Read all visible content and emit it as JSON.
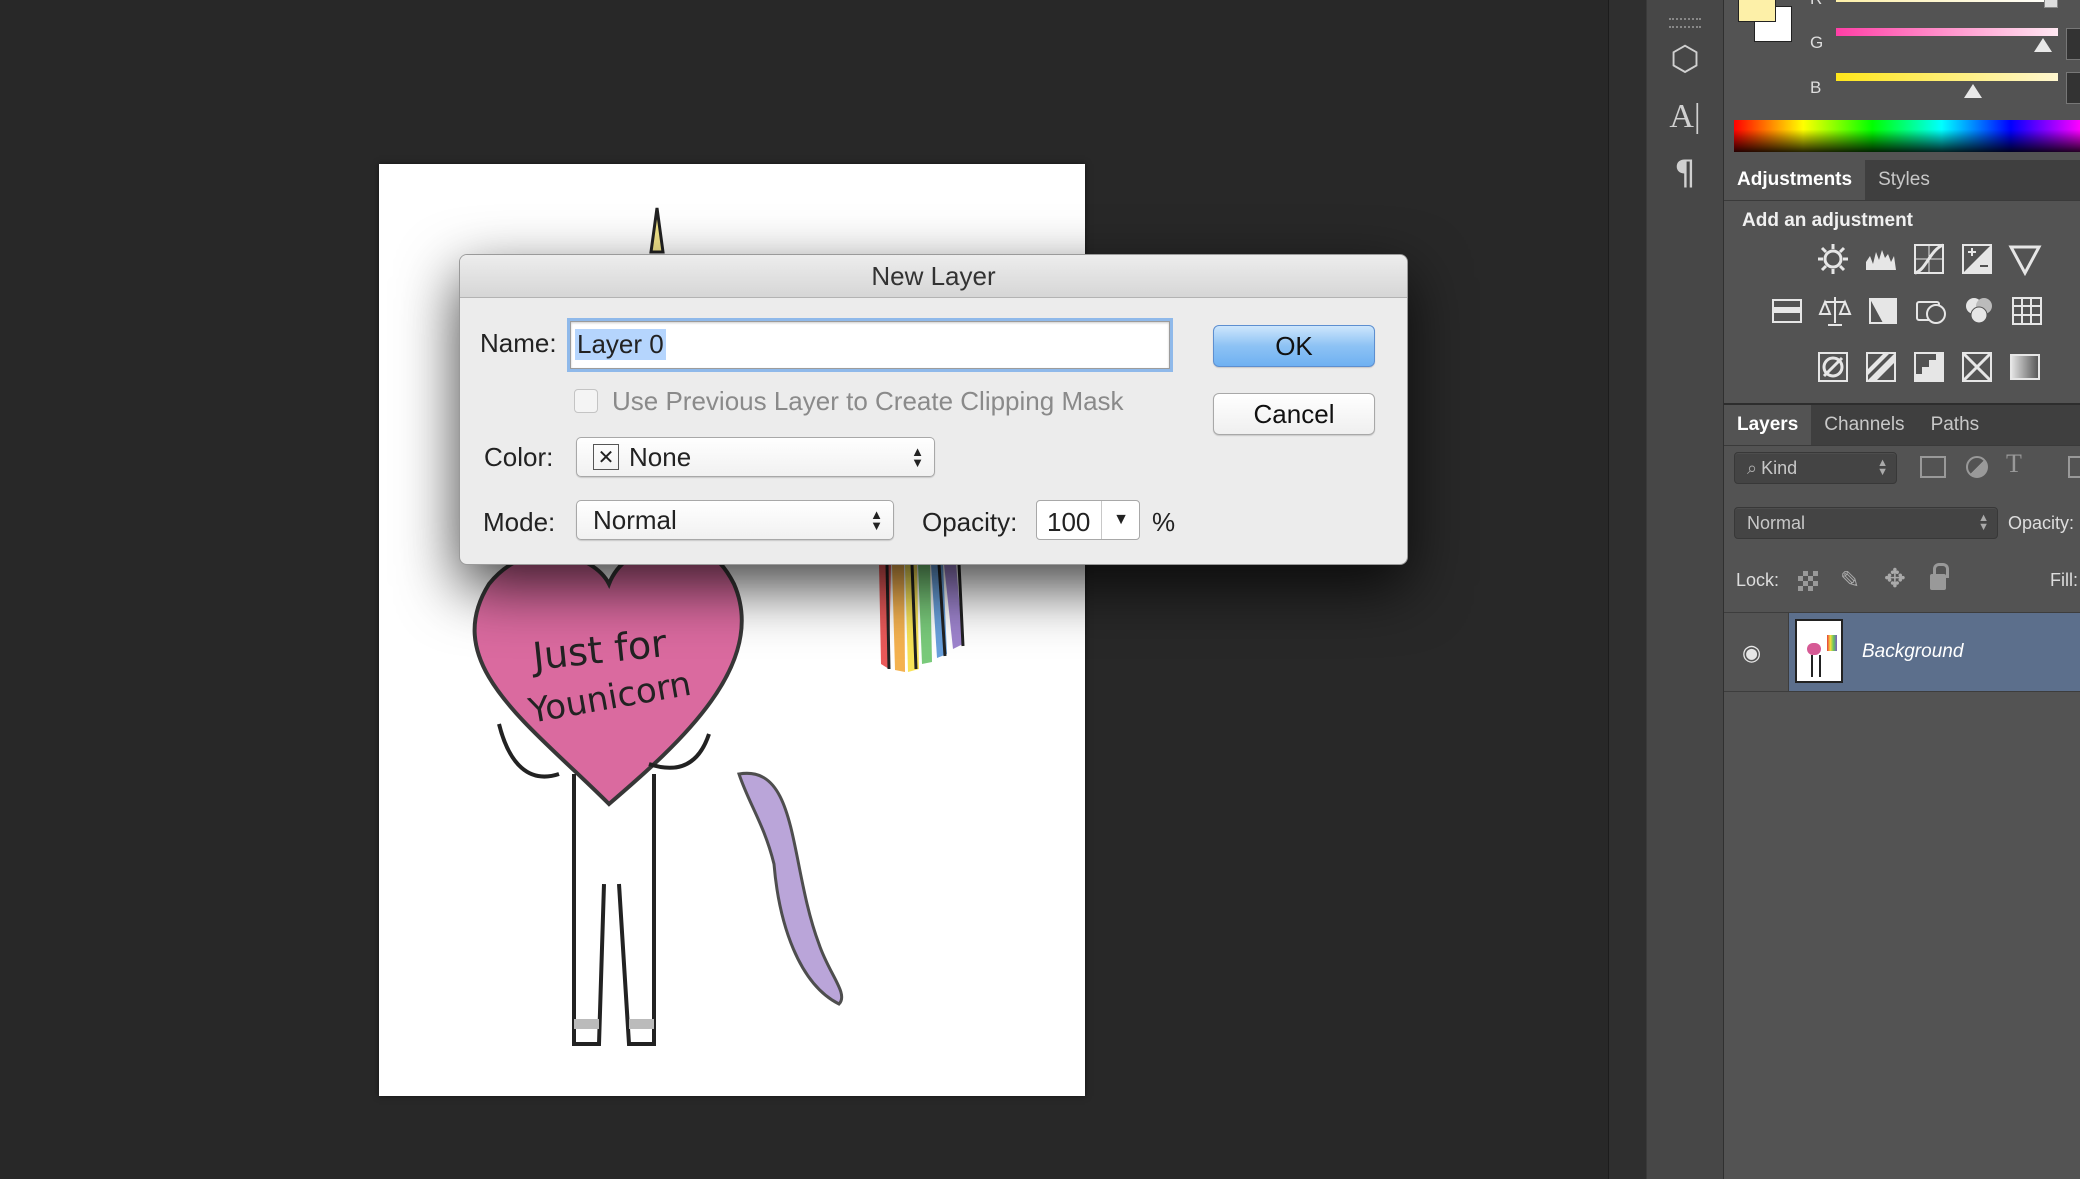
{
  "dialog": {
    "title": "New Layer",
    "name_label": "Name:",
    "name_value": "Layer 0",
    "clip_label": "Use Previous Layer to Create Clipping Mask",
    "clip_checked": false,
    "color_label": "Color:",
    "color_value": "None",
    "color_swatch_symbol": "✕",
    "mode_label": "Mode:",
    "mode_value": "Normal",
    "opacity_label": "Opacity:",
    "opacity_value": "100",
    "opacity_unit": "%",
    "ok_label": "OK",
    "cancel_label": "Cancel"
  },
  "color_panel": {
    "channels": [
      {
        "label": "R",
        "gradient_end": "#ffffff"
      },
      {
        "label": "G",
        "gradient_end": "#ff3fa6"
      },
      {
        "label": "B",
        "gradient_end": "#ffe61a"
      }
    ],
    "foreground_color": "#fdf0a8",
    "background_color": "#ffffff"
  },
  "adjustments_panel": {
    "tabs": [
      "Adjustments",
      "Styles"
    ],
    "active_tab": "Adjustments",
    "heading": "Add an adjustment",
    "icons": [
      [
        "brightness-contrast-icon",
        "levels-icon",
        "curves-icon",
        "exposure-icon",
        "gradient-triangle-icon"
      ],
      [
        "vibrance-icon",
        "color-balance-icon",
        "black-white-icon",
        "photo-filter-icon",
        "channel-mixer-icon",
        "color-lookup-icon"
      ],
      [
        "invert-icon",
        "posterize-icon",
        "threshold-icon",
        "selective-color-icon",
        "gradient-map-icon"
      ]
    ]
  },
  "layers_panel": {
    "tabs": [
      "Layers",
      "Channels",
      "Paths"
    ],
    "active_tab": "Layers",
    "filter_value": "Kind",
    "blend_mode": "Normal",
    "opacity_label": "Opacity:",
    "lock_label": "Lock:",
    "fill_label": "Fill:",
    "layers": [
      {
        "name": "Background",
        "visible": true,
        "selected": true
      }
    ]
  },
  "canvas": {
    "heart_text": [
      "Just for",
      "Younicorn"
    ],
    "colors": {
      "heart": "#d65a95",
      "tail": "#a98fd0",
      "rainbow": [
        "#e53c3c",
        "#f2a531",
        "#f7de3b",
        "#62c163",
        "#4f8fd6",
        "#7d5bbe"
      ]
    }
  },
  "dock": {
    "icons": [
      "3d-cube-icon",
      "character-icon",
      "paragraph-icon"
    ],
    "glyphs": [
      "⬡",
      "A|",
      "¶"
    ]
  }
}
